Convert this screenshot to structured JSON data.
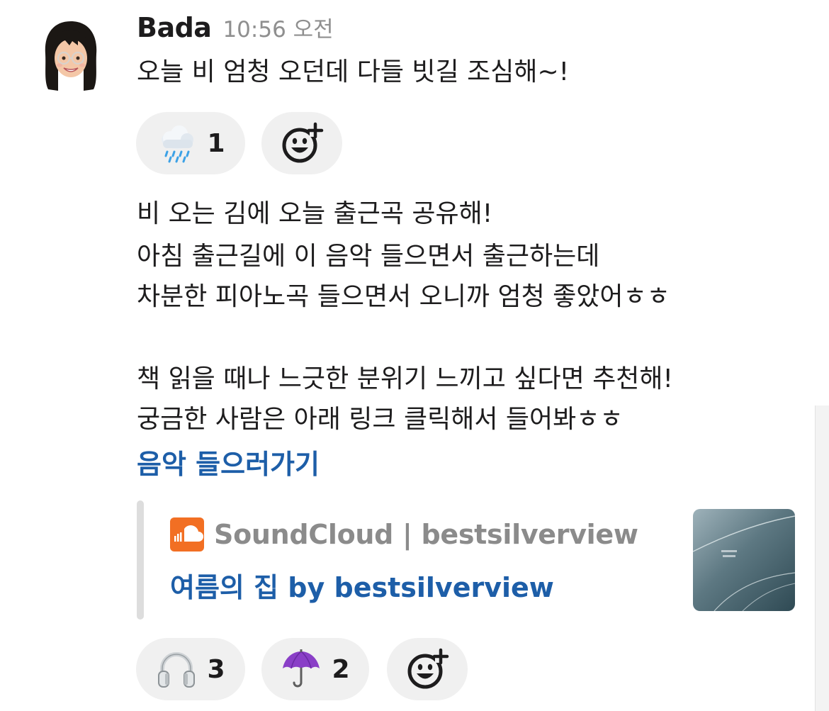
{
  "message": {
    "sender": "Bada",
    "timestamp": "10:56 오전",
    "first_text": "오늘 비 엄청 오던데 다들 빗길 조심해~!",
    "body_lines": [
      "비 오는 김에 오늘 출근곡 공유해!",
      "아침 출근길에 이 음악 들으면서 출근하는데",
      "차분한 피아노곡 들으면서 오니까 엄청 좋았어ㅎㅎ",
      "",
      "책 읽을 때나 느긋한 분위기 느끼고 싶다면 추천해!",
      "궁금한 사람은 아래 링크 클릭해서 들어봐ㅎㅎ"
    ],
    "link_text": "음악 들으러가기"
  },
  "reactions_first": [
    {
      "emoji": "rain-cloud-icon",
      "count": "1"
    }
  ],
  "reactions_second": [
    {
      "emoji": "headphones-icon",
      "count": "3"
    },
    {
      "emoji": "umbrella-icon",
      "count": "2"
    }
  ],
  "unfurl": {
    "source": "SoundCloud | bestsilverview",
    "title": "여름의 집 by bestsilverview"
  },
  "colors": {
    "link": "#1d5ea8",
    "reaction_bg": "#f0f0f0",
    "timestamp": "#8f8f8f",
    "soundcloud": "#f26f23"
  }
}
